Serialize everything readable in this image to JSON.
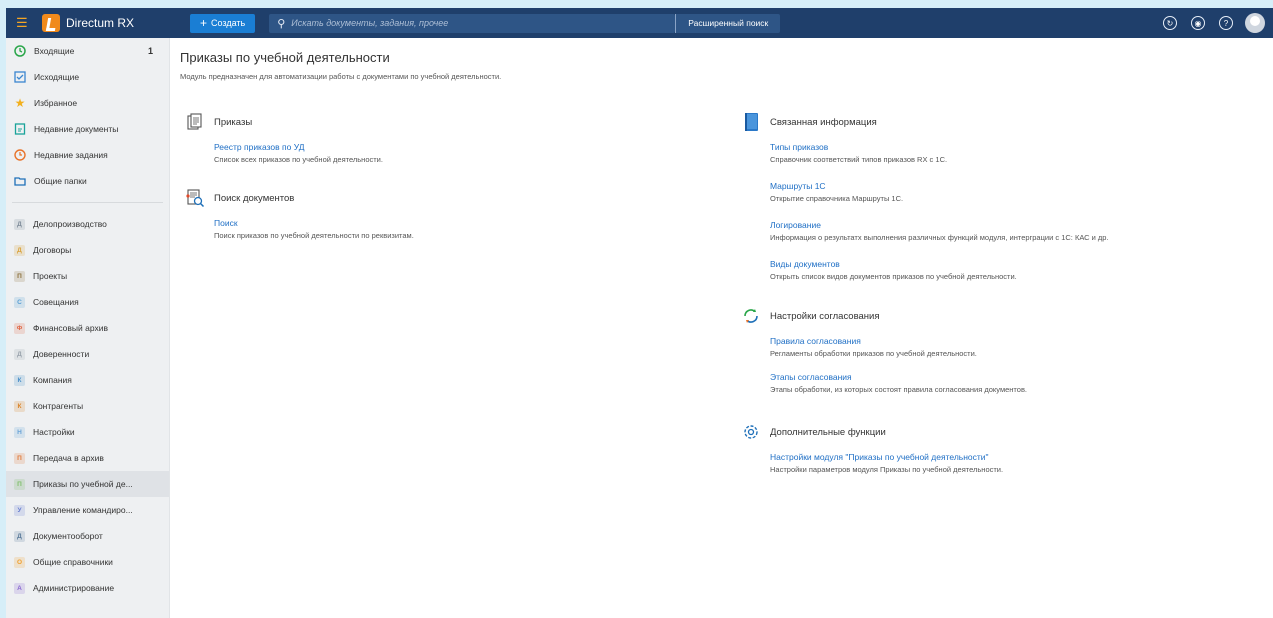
{
  "app": {
    "brand": "Directum RX",
    "create_label": "Создать",
    "search_placeholder": "Искать документы, задания, прочее",
    "adv_search_label": "Расширенный поиск"
  },
  "colors": {
    "topbar": "#1f3f6b",
    "accent": "#1a7ed4",
    "link": "#1f6fc5",
    "sidebar": "#eef0f2"
  },
  "sidebar": {
    "top_items": [
      {
        "label": "Входящие",
        "icon": "clock-icon",
        "count": "1"
      },
      {
        "label": "Исходящие",
        "icon": "outbox-icon"
      },
      {
        "label": "Избранное",
        "icon": "star-icon"
      },
      {
        "label": "Недавние документы",
        "icon": "recent-docs-icon"
      },
      {
        "label": "Недавние задания",
        "icon": "recent-tasks-icon"
      },
      {
        "label": "Общие папки",
        "icon": "folder-icon"
      }
    ],
    "modules": [
      {
        "badge": "Д",
        "label": "Делопроизводство",
        "color": "#7f8c9a"
      },
      {
        "badge": "Д",
        "label": "Договоры",
        "color": "#d9a23a"
      },
      {
        "badge": "П",
        "label": "Проекты",
        "color": "#8b6f3a"
      },
      {
        "badge": "С",
        "label": "Совещания",
        "color": "#5a9fd4"
      },
      {
        "badge": "Ф",
        "label": "Финансовый архив",
        "color": "#e06a4a"
      },
      {
        "badge": "Д",
        "label": "Доверенности",
        "color": "#9aa3ad"
      },
      {
        "badge": "К",
        "label": "Компания",
        "color": "#4a8fc8"
      },
      {
        "badge": "К",
        "label": "Контрагенты",
        "color": "#d9842a"
      },
      {
        "badge": "Н",
        "label": "Настройки",
        "color": "#6aa4d8"
      },
      {
        "badge": "П",
        "label": "Передача в архив",
        "color": "#e07a3a"
      },
      {
        "badge": "П",
        "label": "Приказы по учебной де...",
        "color": "#7fbf6a"
      },
      {
        "badge": "У",
        "label": "Управление командиро...",
        "color": "#6a7fd0"
      },
      {
        "badge": "Д",
        "label": "Документооборот",
        "color": "#5a7a9a"
      },
      {
        "badge": "О",
        "label": "Общие справочники",
        "color": "#f0a030"
      },
      {
        "badge": "А",
        "label": "Администрирование",
        "color": "#8a6ad0"
      }
    ]
  },
  "main": {
    "title": "Приказы по учебной деятельности",
    "subtitle": "Модуль предназначен для автоматизации работы с документами по учебной деятельности.",
    "left": {
      "orders": {
        "heading": "Приказы",
        "link": "Реестр приказов по УД",
        "desc": "Список всех приказов по учебной деятельности."
      },
      "search": {
        "heading": "Поиск документов",
        "link": "Поиск",
        "desc": "Поиск приказов по учебной деятельности по реквизитам."
      }
    },
    "right": {
      "related": {
        "heading": "Связанная информация",
        "items": [
          {
            "link": "Типы приказов",
            "desc": "Справочник соответствий типов приказов RX с 1С."
          },
          {
            "link": "Маршруты 1С",
            "desc": "Открытие справочника Маршруты 1С."
          },
          {
            "link": "Логирование",
            "desc": "Информация о результатх выполнения различных функций модуля, интерграции с 1С: КАС и др."
          },
          {
            "link": "Виды документов",
            "desc": "Открыть список видов документов приказов по учебной деятельности."
          }
        ]
      },
      "approval": {
        "heading": "Настройки согласования",
        "items": [
          {
            "link": "Правила согласования",
            "desc": "Регламенты обработки приказов по учебной деятельности."
          },
          {
            "link": "Этапы согласования",
            "desc": "Этапы обработки, из которых состоят правила согласования документов."
          }
        ]
      },
      "extra": {
        "heading": "Дополнительные функции",
        "items": [
          {
            "link": "Настройки модуля \"Приказы по учебной деятельности\"",
            "desc": "Настройки параметров модуля Приказы по учебной деятельности."
          }
        ]
      }
    }
  }
}
